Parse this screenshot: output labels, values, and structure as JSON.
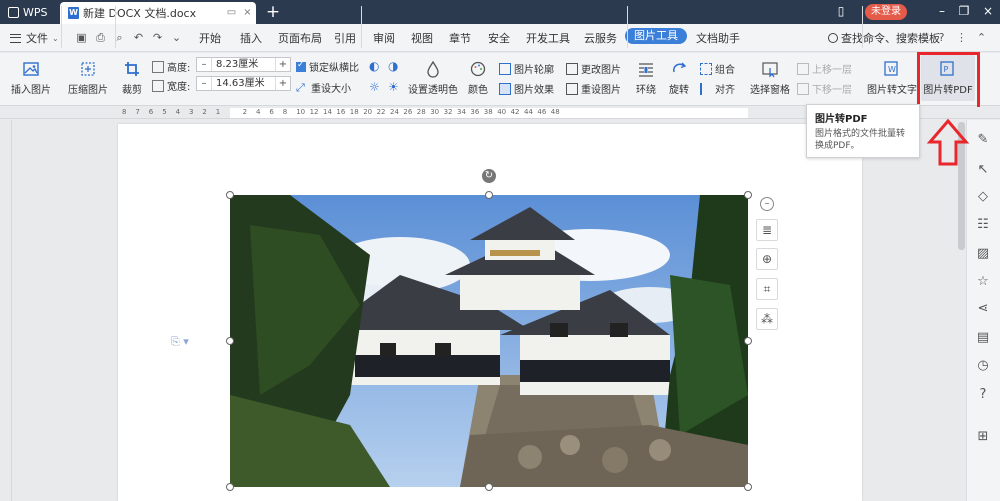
{
  "titlebar": {
    "app_name": "WPS",
    "doc_tab_icon": "W",
    "doc_title": "新建 DOCX 文档.docx",
    "new_tab": "+",
    "login_label": "未登录"
  },
  "menubar": {
    "file_label": "文件",
    "items": [
      "开始",
      "插入",
      "页面布局",
      "引用",
      "审阅",
      "视图",
      "章节",
      "安全",
      "开发工具",
      "云服务",
      "图片工具",
      "文档助手"
    ],
    "active_item": "图片工具",
    "search_label": "查找命令、搜索模板"
  },
  "ribbon": {
    "insert_picture": "插入图片",
    "compress_picture": "压缩图片",
    "crop": "裁剪",
    "height_label": "高度:",
    "height_value": "8.23厘米",
    "width_label": "宽度:",
    "width_value": "14.63厘米",
    "lock_ratio": "锁定纵横比",
    "reset_size": "重设大小",
    "set_transparent": "设置透明色",
    "color": "颜色",
    "picture_outline": "图片轮廓",
    "picture_effect": "图片效果",
    "change_picture": "更改图片",
    "reset_picture": "重设图片",
    "wrap": "环绕",
    "rotate": "旋转",
    "group": "组合",
    "align": "对齐",
    "selection_pane": "选择窗格",
    "bring_forward": "上移一层",
    "send_backward": "下移一层",
    "picture_to_text": "图片转文字",
    "picture_to_pdf": "图片转PDF"
  },
  "tooltip": {
    "title": "图片转PDF",
    "description": "图片格式的文件批量转换成PDF。"
  },
  "ruler": {
    "labels": [
      "8",
      "7",
      "6",
      "5",
      "4",
      "3",
      "2",
      "1",
      "",
      "2",
      "4",
      "6",
      "8",
      "10",
      "12",
      "14",
      "16",
      "18",
      "20",
      "22",
      "24",
      "26",
      "28",
      "30",
      "32",
      "34",
      "36",
      "38",
      "40",
      "42",
      "44",
      "46",
      "48"
    ]
  },
  "colors": {
    "tabbar": "#2b3a4f",
    "accent": "#3b7fd8",
    "login": "#e55b4a",
    "highlight": "#e8262b"
  }
}
